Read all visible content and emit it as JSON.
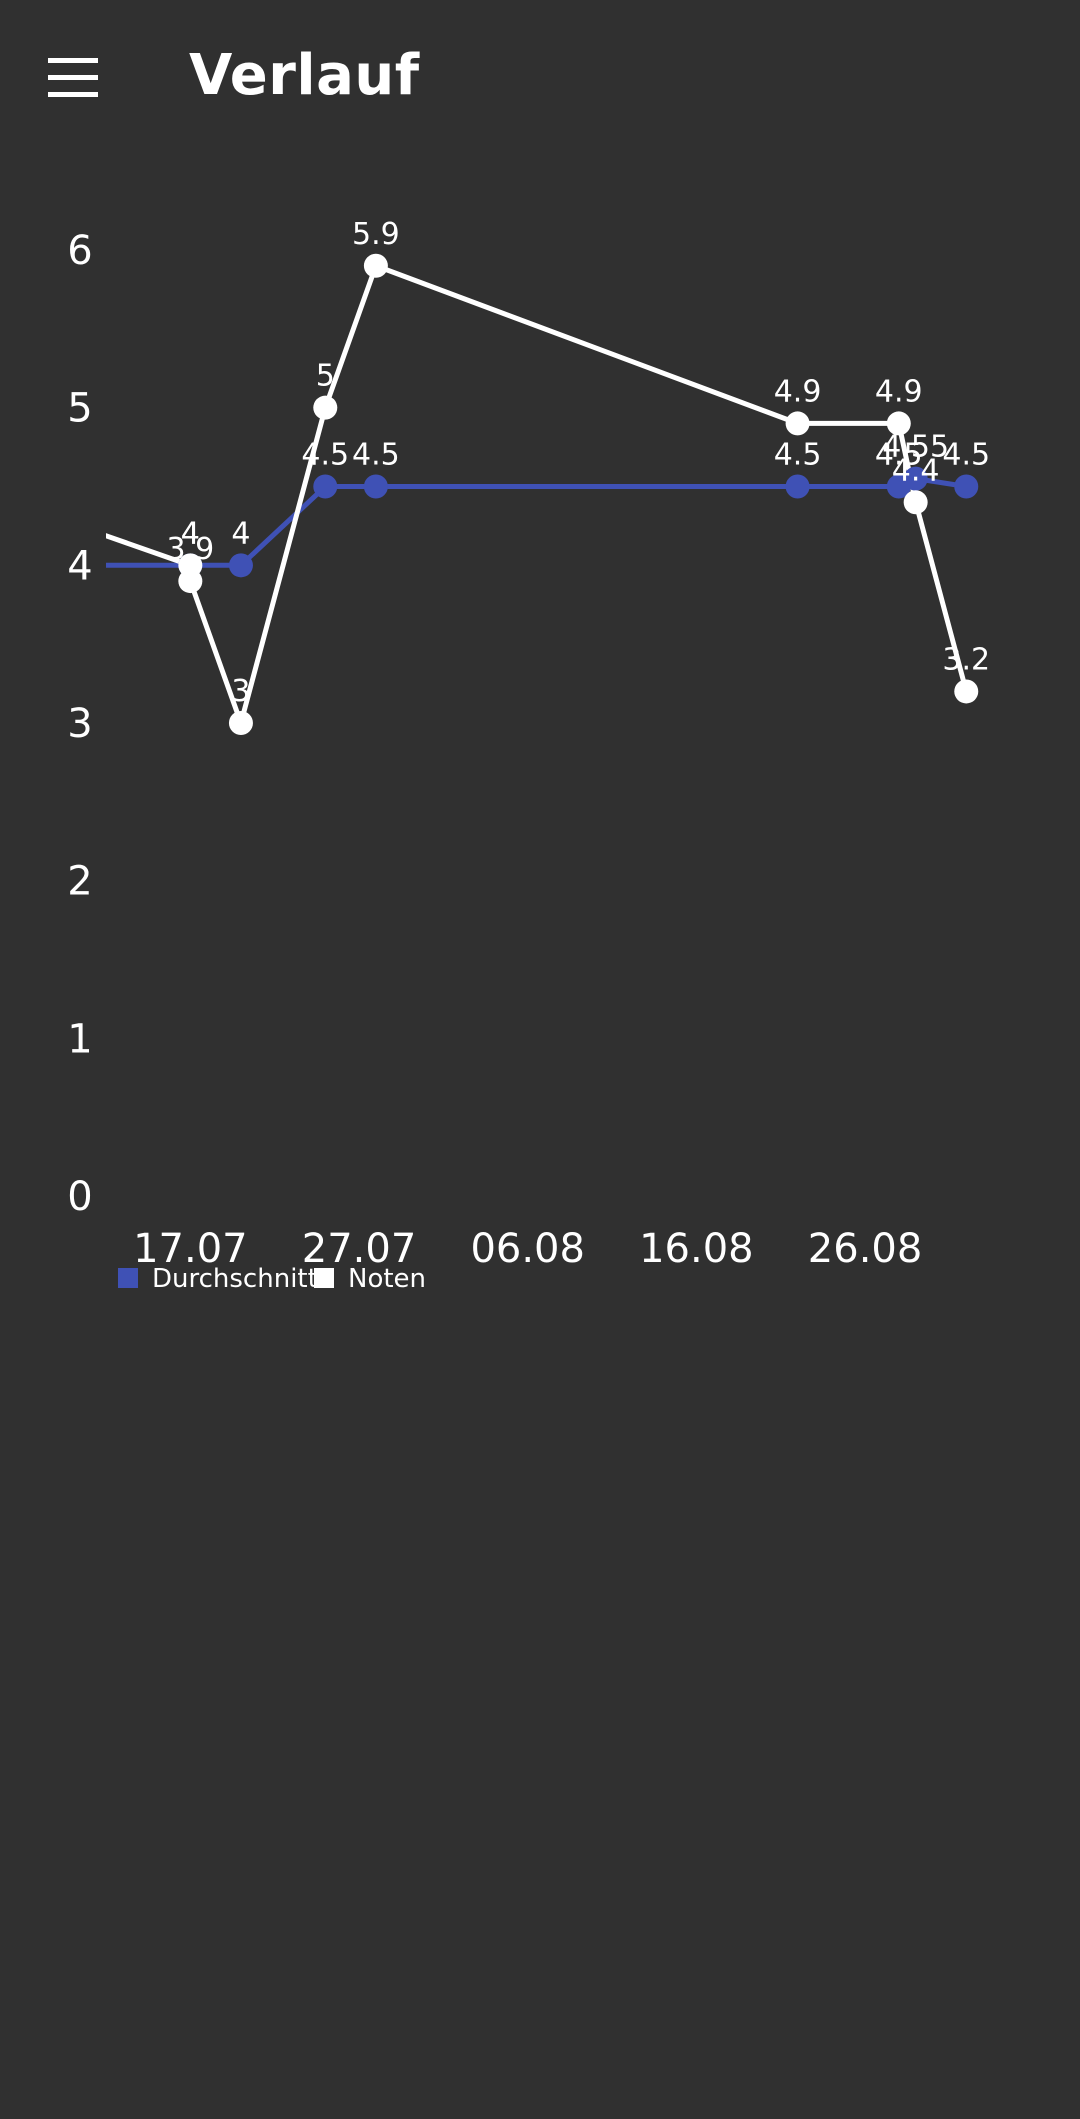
{
  "app_bar": {
    "title": "Verlauf",
    "menu_icon": "hamburger-menu-icon"
  },
  "colors": {
    "background": "#303030",
    "average_series": "#3f51b5",
    "grades_series": "#ffffff",
    "text": "#ffffff"
  },
  "chart_data": {
    "type": "line",
    "x_type": "date",
    "x_ticks": [
      "2017-07-17",
      "2017-07-27",
      "2017-08-06",
      "2017-08-16",
      "2017-08-26"
    ],
    "x_tick_labels": [
      "17.07",
      "27.07",
      "06.08",
      "16.08",
      "26.08"
    ],
    "y_ticks": [
      0,
      1,
      2,
      3,
      4,
      5,
      6
    ],
    "ylim": [
      0,
      6
    ],
    "xlim": [
      "2017-07-12",
      "2017-09-03"
    ],
    "grid": false,
    "legend": "bottom-left",
    "series": [
      {
        "name": "Durchschnitt",
        "color": "#3f51b5",
        "points": [
          {
            "x": "2017-07-09",
            "y": 4
          },
          {
            "x": "2017-07-17",
            "y": 4
          },
          {
            "x": "2017-07-20",
            "y": 4
          },
          {
            "x": "2017-07-25",
            "y": 4.5
          },
          {
            "x": "2017-07-28",
            "y": 4.5
          },
          {
            "x": "2017-08-22",
            "y": 4.5
          },
          {
            "x": "2017-08-28",
            "y": 4.5
          },
          {
            "x": "2017-08-29",
            "y": 4.55
          },
          {
            "x": "2017-09-01",
            "y": 4.5
          }
        ],
        "labels": [
          "",
          "4",
          "4",
          "4.5",
          "4.5",
          "4.5",
          "4.5",
          "4.55",
          "4.5"
        ]
      },
      {
        "name": "Noten",
        "color": "#ffffff",
        "points": [
          {
            "x": "2017-07-09",
            "y": 4.3
          },
          {
            "x": "2017-07-17",
            "y": 4
          },
          {
            "x": "2017-07-17",
            "y": 3.9
          },
          {
            "x": "2017-07-20",
            "y": 3
          },
          {
            "x": "2017-07-25",
            "y": 5
          },
          {
            "x": "2017-07-28",
            "y": 5.9
          },
          {
            "x": "2017-08-22",
            "y": 4.9
          },
          {
            "x": "2017-08-28",
            "y": 4.9
          },
          {
            "x": "2017-08-29",
            "y": 4.4
          },
          {
            "x": "2017-09-01",
            "y": 3.2
          }
        ],
        "labels": [
          "",
          "4",
          "3.9",
          "3",
          "5",
          "5.9",
          "4.9",
          "4.9",
          "4.4",
          "3.2"
        ]
      }
    ]
  }
}
